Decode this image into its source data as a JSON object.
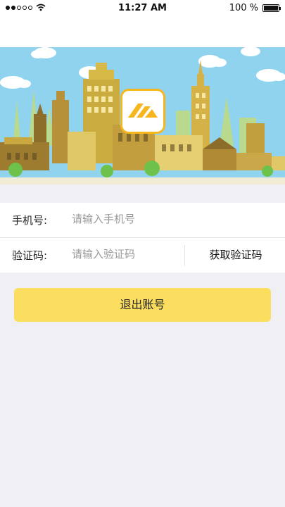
{
  "status_bar": {
    "time": "11:27 AM",
    "battery_text": "100 %",
    "signal_icon": "signal-dots-icon",
    "wifi_icon": "wifi-icon",
    "battery_icon": "battery-icon"
  },
  "banner": {
    "image": "city-skyline-illustration",
    "logo_icon": "app-logo-icon"
  },
  "form": {
    "phone": {
      "label": "手机号:",
      "placeholder": "请输入手机号",
      "value": ""
    },
    "code": {
      "label": "验证码:",
      "placeholder": "请输入验证码",
      "value": "",
      "get_code_label": "获取验证码"
    }
  },
  "logout_button": {
    "label": "退出账号"
  },
  "colors": {
    "accent": "#fbdd5f",
    "logo_border": "#f5b61e",
    "background": "#efeff4",
    "sky": "#8fd3ef"
  }
}
